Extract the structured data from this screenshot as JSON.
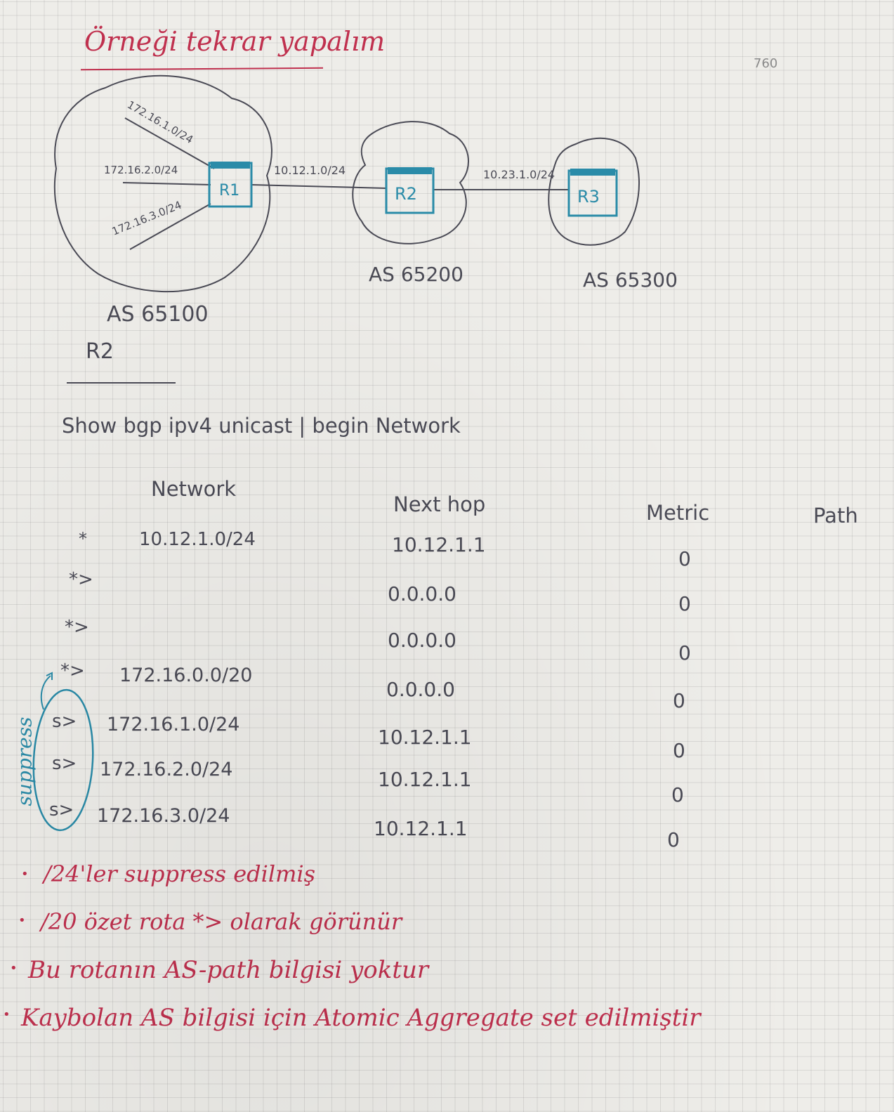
{
  "title": "Örneği tekrar yapalım",
  "page_number": "760",
  "diagram": {
    "links": {
      "r1_r2": "10.12.1.0/24",
      "r2_r3": "10.23.1.0/24"
    },
    "r1_networks": [
      "172.16.1.0/24",
      "172.16.2.0/24",
      "172.16.3.0/24"
    ],
    "routers": [
      "R1",
      "R2",
      "R3"
    ],
    "as_labels": [
      "AS 65100",
      "AS 65200",
      "AS 65300"
    ]
  },
  "router_heading": "R2",
  "command": "Show bgp ipv4 unicast | begin Network",
  "table": {
    "headers": [
      "Network",
      "Next hop",
      "Metric",
      "Path"
    ],
    "rows": [
      {
        "status": "*",
        "network": "10.12.1.0/24",
        "next_hop": "10.12.1.1",
        "metric": "0"
      },
      {
        "status": "*>",
        "network": "",
        "next_hop": "0.0.0.0",
        "metric": "0"
      },
      {
        "status": "*>",
        "network": "",
        "next_hop": "0.0.0.0",
        "metric": "0"
      },
      {
        "status": "*>",
        "network": "172.16.0.0/20",
        "next_hop": "0.0.0.0",
        "metric": "0"
      },
      {
        "status": "s>",
        "network": "172.16.1.0/24",
        "next_hop": "10.12.1.1",
        "metric": "0"
      },
      {
        "status": "s>",
        "network": "172.16.2.0/24",
        "next_hop": "10.12.1.1",
        "metric": "0"
      },
      {
        "status": "s>",
        "network": "172.16.3.0/24",
        "next_hop": "10.12.1.1",
        "metric": "0"
      }
    ],
    "side_note": "suppress"
  },
  "notes": [
    "/24'ler suppress edilmiş",
    "/20 özet rota *> olarak görünür",
    "Bu rotanın AS-path bilgisi yoktur",
    "Kaybolan AS bilgisi için Atomic Aggregate set edilmiştir"
  ],
  "colors": {
    "red_ink": "#c0304e",
    "blue_ink": "#2a8ba8",
    "dark_ink": "#4a4a55",
    "paper": "#eeede9"
  }
}
